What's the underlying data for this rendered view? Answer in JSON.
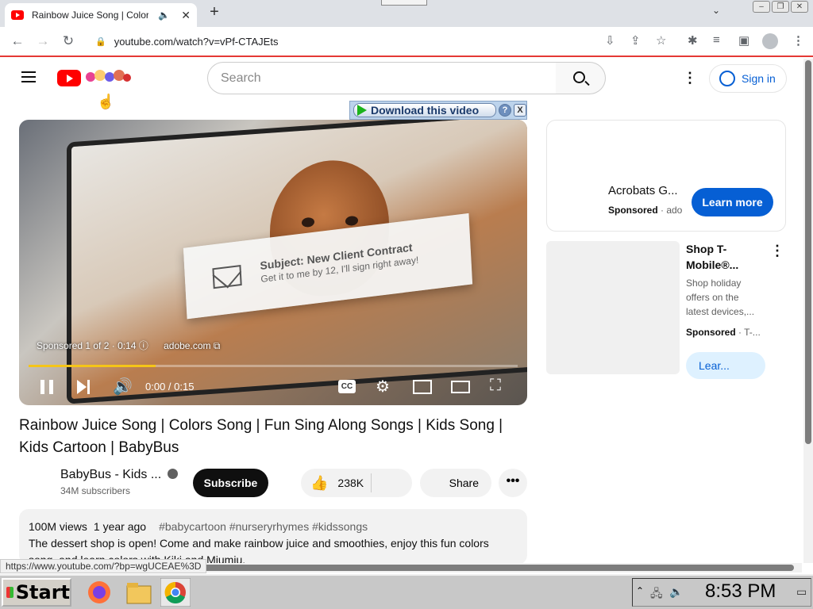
{
  "browser": {
    "tab_title": "Rainbow Juice Song | Colors Song",
    "new_tab": "+",
    "url": "youtube.com/watch?v=vPf-CTAJEts",
    "status_url": "https://www.youtube.com/?bp=wgUCEAE%3D"
  },
  "header": {
    "search_placeholder": "Search",
    "sign_in": "Sign in",
    "more": "⋮"
  },
  "download_bar": {
    "label": "Download this video",
    "help": "?",
    "close": "X"
  },
  "player": {
    "card_subject": "Subject: New Client Contract",
    "card_body": "Get it to me by 12, I'll sign right away!",
    "ad_label": "Sponsored 1 of 2 · 0:14 ⓘ",
    "ad_domain": "adobe.com ⧉",
    "time": "0:00 / 0:15",
    "progress": 0.26,
    "cc": "CC"
  },
  "video": {
    "title": "Rainbow Juice Song | Colors Song | Fun Sing Along Songs | Kids Song | Kids Cartoon | BabyBus",
    "channel": "BabyBus - Kids ...",
    "subscribers": "34M subscribers",
    "subscribe": "Subscribe",
    "likes": "238K",
    "share": "Share",
    "more": "•••",
    "views": "100M views",
    "age": "1 year ago",
    "tags": "#babycartoon #nurseryrhymes #kidssongs",
    "description": "The dessert shop is open! Come and make rainbow juice and smoothies, enjoy this fun colors song, and learn colors with Kiki and Miumiu."
  },
  "sidebar": {
    "ad1": {
      "title": "Acrobats G...",
      "sponsored": "Sponsored",
      "advertiser": " · ado",
      "cta": "Learn more"
    },
    "ad2": {
      "title": "Shop T-Mobile®...",
      "description": "Shop holiday offers on the latest devices,...",
      "sponsored": "Sponsored",
      "advertiser": " · T-...",
      "cta": "Lear..."
    }
  },
  "taskbar": {
    "start": "Start",
    "clock": "8:53 PM"
  }
}
